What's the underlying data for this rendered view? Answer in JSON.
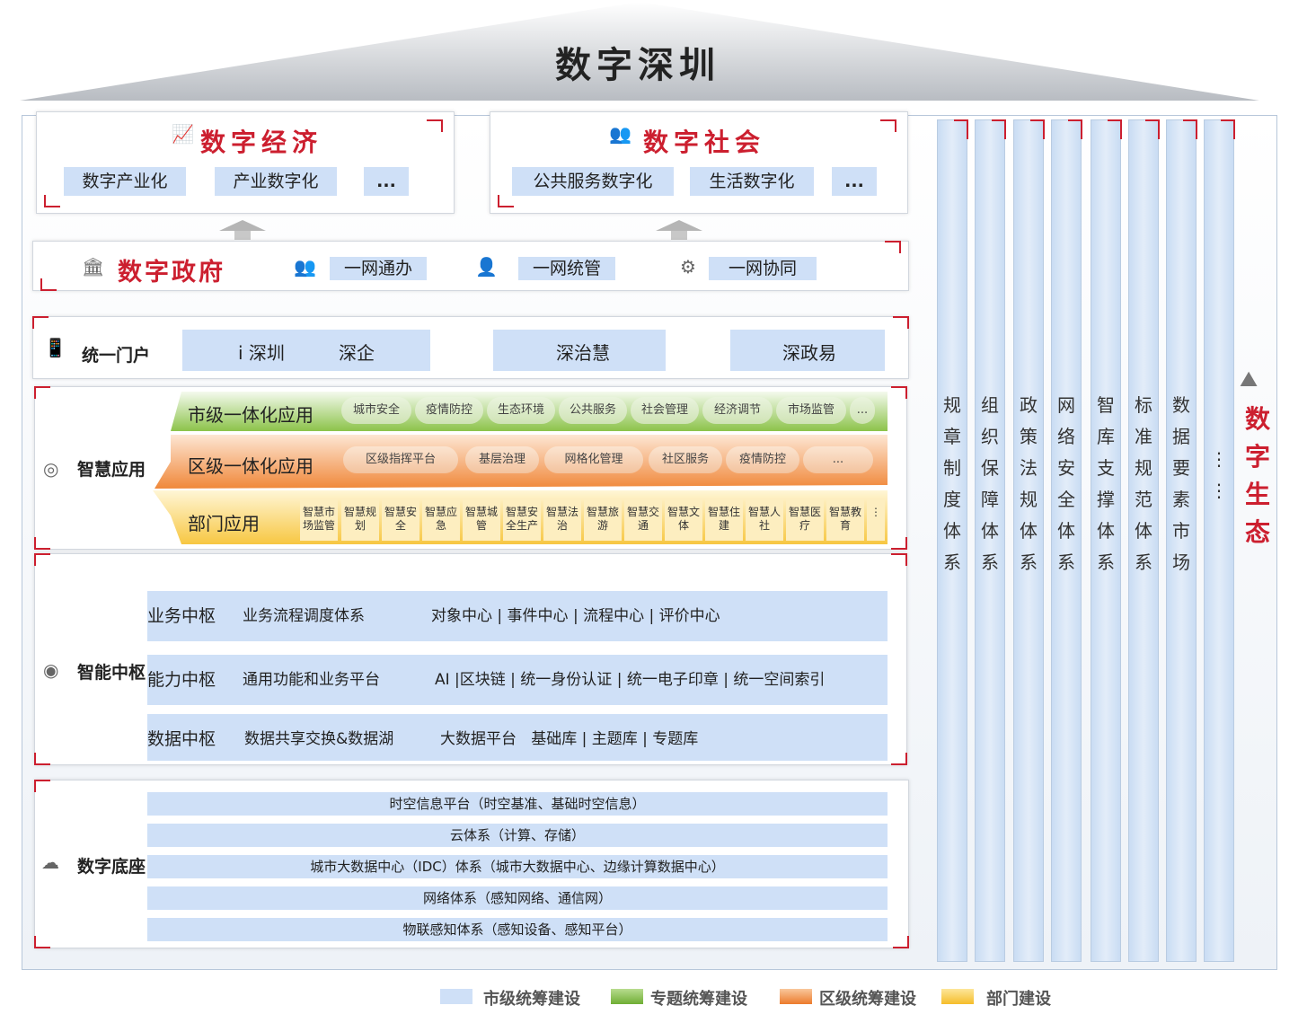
{
  "title": "数字深圳",
  "economy": {
    "title": "数字经济",
    "items": [
      "数字产业化",
      "产业数字化",
      "..."
    ]
  },
  "society": {
    "title": "数字社会",
    "items": [
      "公共服务数字化",
      "生活数字化",
      "..."
    ]
  },
  "government": {
    "title": "数字政府",
    "items": [
      "一网通办",
      "一网统管",
      "一网协同"
    ]
  },
  "portal": {
    "label": "统一门户",
    "items": [
      "i 深圳",
      "深企",
      "深治慧",
      "深政易"
    ]
  },
  "smart_apps": {
    "label": "智慧应用",
    "city_row": {
      "label": "市级一体化应用",
      "items": [
        "城市安全",
        "疫情防控",
        "生态环境",
        "公共服务",
        "社会管理",
        "经济调节",
        "市场监管",
        "..."
      ]
    },
    "district_row": {
      "label": "区级一体化应用",
      "items": [
        "区级指挥平台",
        "基层治理",
        "网格化管理",
        "社区服务",
        "疫情防控",
        "..."
      ]
    },
    "dept_row": {
      "label": "部门应用",
      "items": [
        "智慧市场监管",
        "智慧规划",
        "智慧安全",
        "智慧应急",
        "智慧城管",
        "智慧安全生产",
        "智慧法治",
        "智慧旅游",
        "智慧交通",
        "智慧文体",
        "智慧住建",
        "智慧人社",
        "智慧医疗",
        "智慧教育"
      ],
      "more": "⋮"
    }
  },
  "hub": {
    "label": "智能中枢",
    "rows": [
      {
        "name": "业务中枢",
        "a": "业务流程调度体系",
        "b": "对象中心 | 事件中心 | 流程中心 | 评价中心"
      },
      {
        "name": "能力中枢",
        "a": "通用功能和业务平台",
        "b": "AI |区块链 | 统一身份认证 | 统一电子印章 | 统一空间索引"
      },
      {
        "name": "数据中枢",
        "a": "数据共享交换&数据湖",
        "b": "大数据平台   基础库 | 主题库 | 专题库"
      }
    ]
  },
  "base": {
    "label": "数字底座",
    "rows": [
      "时空信息平台（时空基准、基础时空信息）",
      "云体系（计算、存储）",
      "城市大数据中心（IDC）体系（城市大数据中心、边缘计算数据中心）",
      "网络体系（感知网络、通信网）",
      "物联感知体系（感知设备、感知平台）"
    ]
  },
  "pillars": [
    "规章制度体系",
    "组织保障体系",
    "政策法规体系",
    "网络安全体系",
    "智库支撑体系",
    "标准规范体系",
    "数据要素市场",
    "⋮⋮"
  ],
  "ecology": "数字生态",
  "legend": [
    "市级统筹建设",
    "专题统筹建设",
    "区级统筹建设",
    "部门建设"
  ],
  "colors": {
    "red": "#cc1f2f",
    "blue": "#cfe0f7",
    "green": "#7fbf3f",
    "orange": "#f0883a",
    "yellow": "#f7c742"
  },
  "icons": [
    "chart-icon",
    "people-icon",
    "building-icon",
    "users-icon",
    "admin-icon",
    "gear-icon",
    "phone-icon",
    "network-icon",
    "chip-icon",
    "cloud-icon",
    "ecology-icon"
  ]
}
